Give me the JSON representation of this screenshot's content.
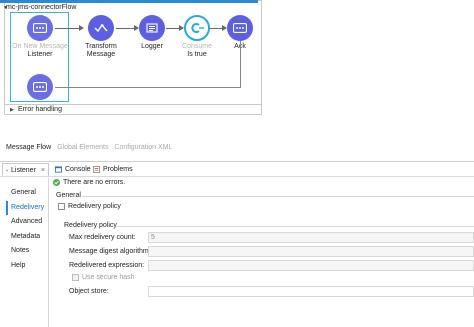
{
  "flow": {
    "title": "mc-jms-connectorFlow",
    "nodes": [
      {
        "name": "On New Message",
        "sub": "Listener"
      },
      {
        "name": "Transform",
        "sub": "Message"
      },
      {
        "name": "Logger",
        "sub": ""
      },
      {
        "name": "Consume",
        "sub": "Is true"
      },
      {
        "name": "Ack",
        "sub": ""
      }
    ],
    "error_handling": "Error handling"
  },
  "editor_tabs": [
    "Message Flow",
    "Global Elements",
    "Configuration XML"
  ],
  "panel_tabs": {
    "listener": "Listener",
    "console": "Console",
    "problems": "Problems"
  },
  "nav": [
    "General",
    "Redelivery",
    "Advanced",
    "Metadata",
    "Notes",
    "Help"
  ],
  "content": {
    "status": "There are no errors.",
    "general_label": "General",
    "redelivery_checkbox": "Redelivery policy",
    "policy_label": "Redelivery policy",
    "fields": {
      "max_count_label": "Max redelivery count:",
      "max_count_value": "5",
      "digest_label": "Message digest algorithm:",
      "digest_value": "",
      "expression_label": "Redelivered expression:",
      "expression_value": "",
      "secure_hash_label": "Use secure hash",
      "object_store_label": "Object store:",
      "object_store_value": ""
    }
  },
  "colors": {
    "flow_node": "#5c5fe0",
    "flow_node_faded": "#a9abe8",
    "accent_blue": "#2a8ad6",
    "source_border": "#37b8c9",
    "ok_green": "#4caf50"
  }
}
